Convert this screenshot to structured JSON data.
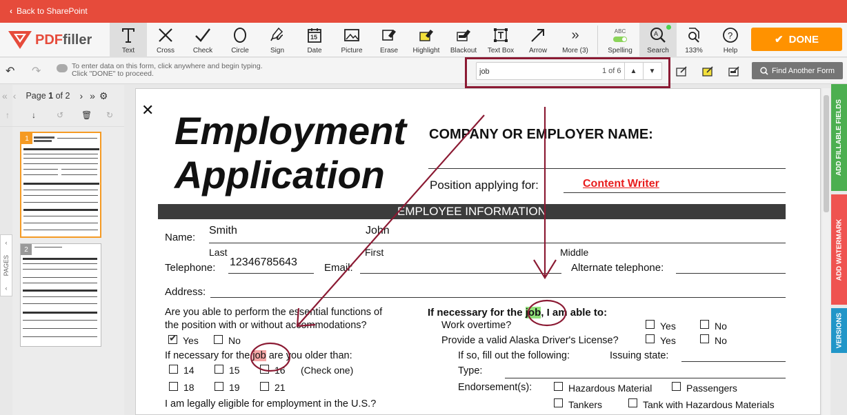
{
  "topbar": {
    "back_label": "Back to SharePoint"
  },
  "logo": {
    "text_a": "PDF",
    "text_b": "filler"
  },
  "tools": [
    {
      "label": "Text",
      "icon": "text-icon"
    },
    {
      "label": "Cross",
      "icon": "cross-icon"
    },
    {
      "label": "Check",
      "icon": "check-icon"
    },
    {
      "label": "Circle",
      "icon": "circle-icon"
    },
    {
      "label": "Sign",
      "icon": "sign-icon"
    },
    {
      "label": "Date",
      "icon": "date-icon",
      "day": "15"
    },
    {
      "label": "Picture",
      "icon": "picture-icon"
    },
    {
      "label": "Erase",
      "icon": "erase-icon"
    },
    {
      "label": "Highlight",
      "icon": "highlight-icon"
    },
    {
      "label": "Blackout",
      "icon": "blackout-icon"
    },
    {
      "label": "Text Box",
      "icon": "textbox-icon"
    },
    {
      "label": "Arrow",
      "icon": "arrow-icon"
    },
    {
      "label": "More (3)",
      "icon": "more-icon"
    },
    {
      "label": "Spelling",
      "icon": "spelling-icon",
      "abc": "ABC"
    },
    {
      "label": "Search",
      "icon": "search-icon"
    },
    {
      "label": "133%",
      "icon": "zoom-icon"
    },
    {
      "label": "Help",
      "icon": "help-icon"
    }
  ],
  "done_label": "DONE",
  "hint": {
    "line1": "To enter data on this form, click anywhere and begin typing.",
    "line2": "Click \"DONE\" to proceed."
  },
  "search": {
    "value": "job",
    "count": "1 of 6"
  },
  "find_another_label": "Find Another Form",
  "pagenav": {
    "prefix": "Page",
    "current": "1",
    "suffix": "of 2"
  },
  "pages_tab": "PAGES",
  "thumbs": [
    {
      "num": "1"
    },
    {
      "num": "2"
    }
  ],
  "right_tabs": [
    {
      "label": "ADD FILLABLE FIELDS",
      "color": "#4caf50"
    },
    {
      "label": "ADD WATERMARK",
      "color": "#ef5350"
    },
    {
      "label": "VERSIONS",
      "color": "#2196c8"
    }
  ],
  "document": {
    "title1": "Employment",
    "title2": "Application",
    "company_label": "COMPANY OR EMPLOYER NAME:",
    "position_label": "Position applying for:",
    "position_value": "Content Writer",
    "section_header": "EMPLOYEE INFORMATION",
    "name_label": "Name:",
    "last_value": "Smith",
    "first_value": "John",
    "last_label": "Last",
    "first_label": "First",
    "middle_label": "Middle",
    "telephone_label": "Telephone:",
    "telephone_value": "12346785643",
    "email_label": "Email:",
    "alt_phone_label": "Alternate telephone:",
    "address_label": "Address:",
    "q1_line1": "Are you able to perform the essential functions of",
    "q1_line2": "the position with or without accommodations?",
    "yes": "Yes",
    "no": "No",
    "q2_pre": "If necessary for the ",
    "q2_hl": "job",
    "q2_post": " are you older than:",
    "age14": "14",
    "age15": "15",
    "age16": "16",
    "age18": "18",
    "age19": "19",
    "age21": "21",
    "check_one": "(Check one)",
    "eligible": "I am legally eligible for employment in the U.S.?",
    "r_head_pre": "If necessary for the ",
    "r_head_hl": "job",
    "r_head_post": ", I am able to:",
    "overtime": "Work overtime?",
    "license": "Provide a valid Alaska Driver's License?",
    "if_so": "If so, fill out the following:",
    "issuing": "Issuing state:",
    "type": "Type:",
    "endorsement": "Endorsement(s):",
    "hazmat": "Hazardous Material",
    "passengers": "Passengers",
    "tankers": "Tankers",
    "tank_hazmat": "Tank with Hazardous Materials"
  },
  "colors": {
    "brand": "#e64b3b",
    "done": "#ff9200",
    "annotation": "#8b1a33"
  }
}
